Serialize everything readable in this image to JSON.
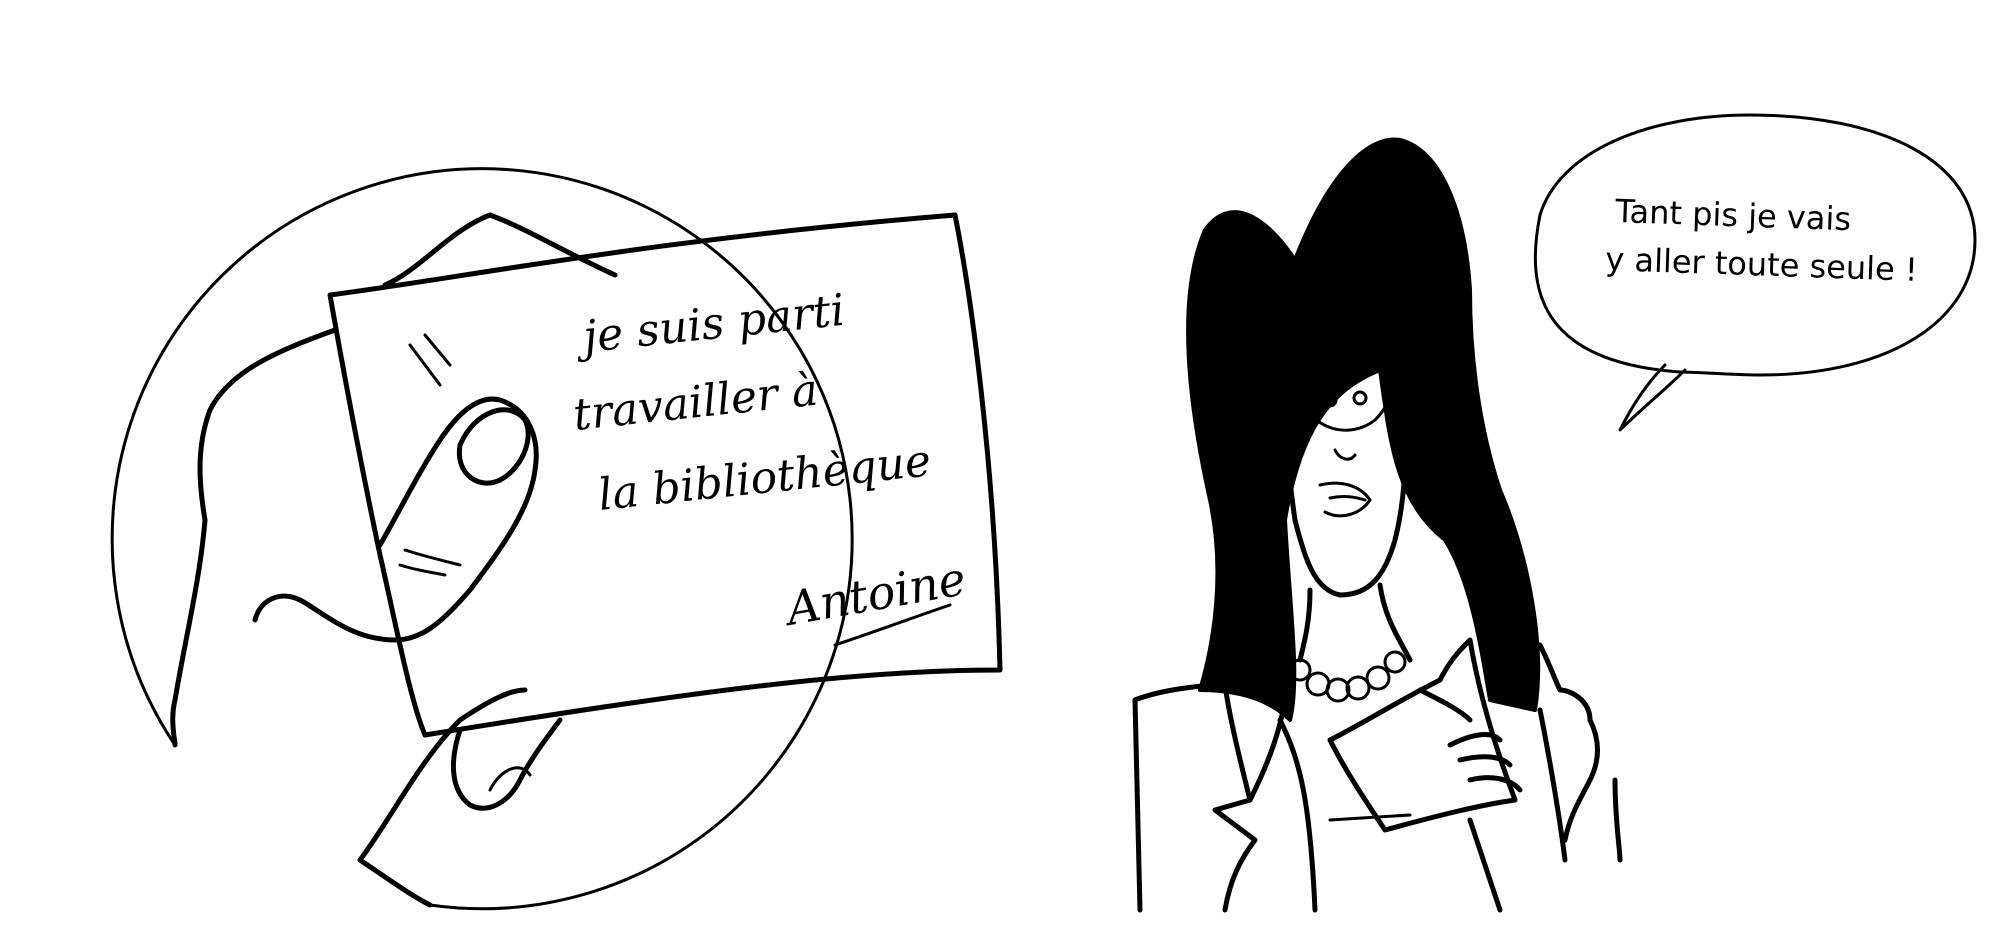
{
  "note": {
    "lines": [
      "je suis parti",
      "travailler à",
      "la bibliothèque"
    ],
    "signature": "Antoine"
  },
  "speech_bubble": {
    "lines": [
      "Tant pis je vais",
      "y aller toute seule !"
    ]
  },
  "colors": {
    "ink": "#000000",
    "paper": "#ffffff"
  }
}
